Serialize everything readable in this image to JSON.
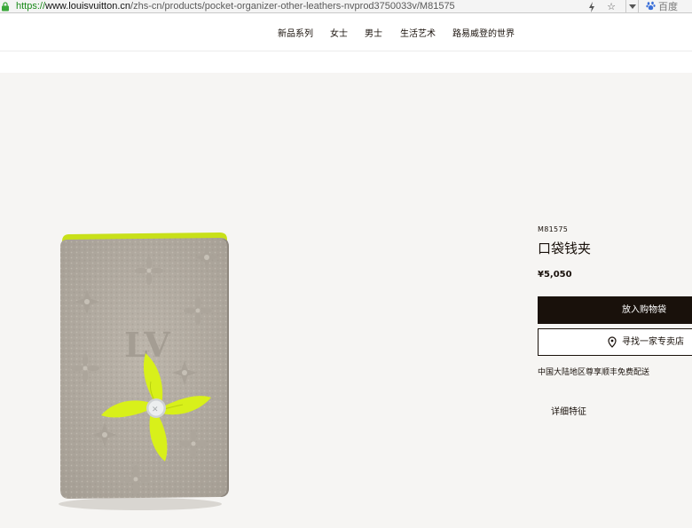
{
  "browser": {
    "url_scheme": "https://",
    "url_host": "www.louisvuitton.cn",
    "url_path": "/zhs-cn/products/pocket-organizer-other-leathers-nvprod3750033v/M81575",
    "search_engine_label": "百度",
    "icons": [
      "lock-icon",
      "lightning-icon",
      "star-icon",
      "dropdown-icon",
      "baidu-paw-icon"
    ]
  },
  "nav": {
    "items": [
      "新品系列",
      "女士",
      "男士",
      "生活艺术",
      "路易威登的世界"
    ]
  },
  "product": {
    "sku": "M81575",
    "name": "口袋钱夹",
    "price": "¥5,050",
    "add_to_bag_label": "放入购物袋",
    "find_store_label": "寻找一家专卖店",
    "shipping_note": "中国大陆地区尊享顺丰免费配送",
    "details_label": "详细特征",
    "colors": {
      "leather": "#b3aca2",
      "edge": "#c8e019",
      "flower": "#d8f01a",
      "button_dark": "#19110b"
    }
  }
}
